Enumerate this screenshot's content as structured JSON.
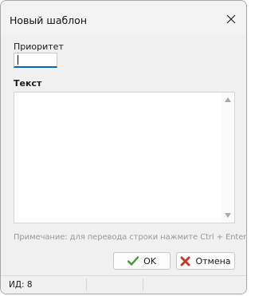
{
  "window": {
    "title": "Новый шаблон"
  },
  "form": {
    "priority_label": "Приоритет",
    "priority_value": "",
    "text_label": "Текст",
    "text_value": "",
    "note": "Примечание: для перевода строки нажмите Ctrl + Enter."
  },
  "buttons": {
    "ok_label": "OK",
    "cancel_label": "Отмена"
  },
  "status": {
    "id_text": "ИД: 8"
  },
  "colors": {
    "accent": "#0067c0",
    "ok_green": "#3c9a2f",
    "cancel_red": "#c0392b"
  }
}
